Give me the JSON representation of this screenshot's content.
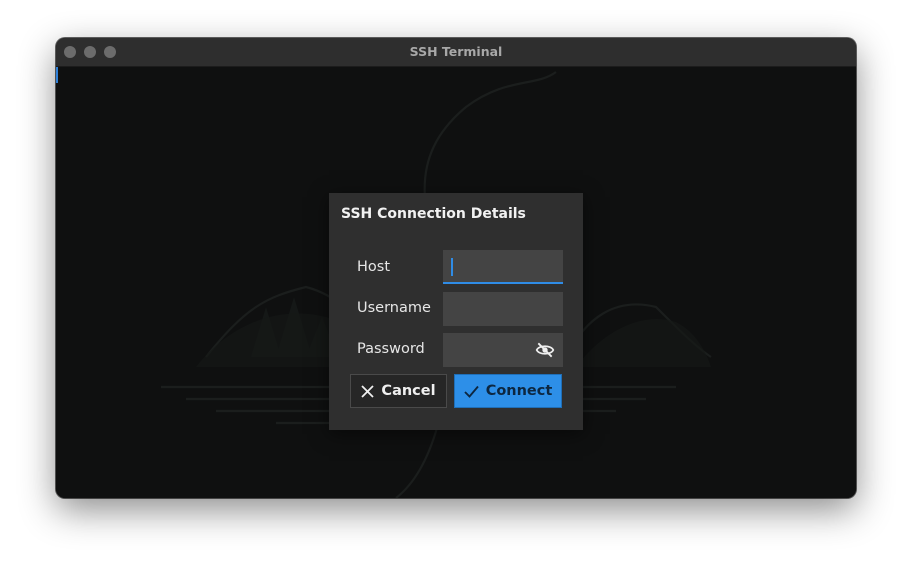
{
  "window": {
    "title": "SSH Terminal"
  },
  "dialog": {
    "title": "SSH Connection Details",
    "fields": {
      "host": {
        "label": "Host",
        "value": ""
      },
      "username": {
        "label": "Username",
        "value": ""
      },
      "password": {
        "label": "Password",
        "value": ""
      }
    },
    "buttons": {
      "cancel": "Cancel",
      "connect": "Connect"
    }
  },
  "icons": {
    "close_window": "traffic-light",
    "cancel": "x-icon",
    "connect": "check-icon",
    "password_toggle": "eye-off-icon"
  },
  "colors": {
    "accent": "#2d8fe8",
    "terminal_bg": "#0f1010",
    "dialog_bg": "#2f2f2f",
    "field_bg": "#444444"
  }
}
